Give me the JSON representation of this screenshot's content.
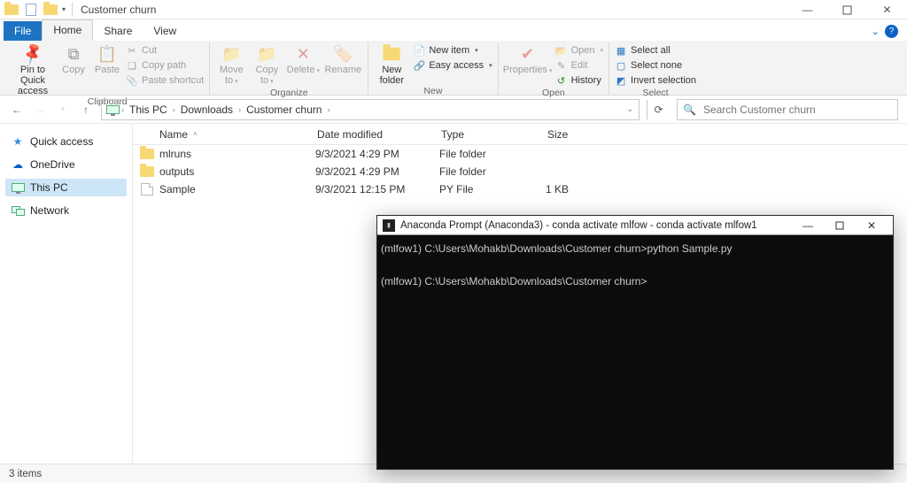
{
  "colors": {
    "accent": "#1e74c3",
    "selection": "#cde6f7"
  },
  "titlebar": {
    "window_title": "Customer churn"
  },
  "tabs": {
    "file": "File",
    "home": "Home",
    "share": "Share",
    "view": "View"
  },
  "ribbon": {
    "clipboard": {
      "label": "Clipboard",
      "pin": "Pin to Quick access",
      "copy": "Copy",
      "paste": "Paste",
      "cut": "Cut",
      "copy_path": "Copy path",
      "paste_shortcut": "Paste shortcut"
    },
    "organize": {
      "label": "Organize",
      "move_to": "Move to",
      "copy_to": "Copy to",
      "delete": "Delete",
      "rename": "Rename"
    },
    "new": {
      "label": "New",
      "new_folder": "New folder",
      "new_item": "New item",
      "easy_access": "Easy access"
    },
    "open": {
      "label": "Open",
      "properties": "Properties",
      "open": "Open",
      "edit": "Edit",
      "history": "History"
    },
    "select": {
      "label": "Select",
      "select_all": "Select all",
      "select_none": "Select none",
      "invert": "Invert selection"
    }
  },
  "breadcrumbs": {
    "root": "This PC",
    "mid": "Downloads",
    "leaf": "Customer churn"
  },
  "search": {
    "placeholder": "Search Customer churn"
  },
  "nav": {
    "quick_access": "Quick access",
    "onedrive": "OneDrive",
    "this_pc": "This PC",
    "network": "Network"
  },
  "columns": {
    "name": "Name",
    "date": "Date modified",
    "type": "Type",
    "size": "Size"
  },
  "files": [
    {
      "icon": "folder",
      "name": "mlruns",
      "date": "9/3/2021 4:29 PM",
      "type": "File folder",
      "size": ""
    },
    {
      "icon": "folder",
      "name": "outputs",
      "date": "9/3/2021 4:29 PM",
      "type": "File folder",
      "size": ""
    },
    {
      "icon": "pyfile",
      "name": "Sample",
      "date": "9/3/2021 12:15 PM",
      "type": "PY File",
      "size": "1 KB"
    }
  ],
  "status": {
    "items": "3 items"
  },
  "console": {
    "title": "Anaconda Prompt (Anaconda3) - conda  activate mlfow - conda  activate mlfow1",
    "line1": "(mlfow1) C:\\Users\\Mohakb\\Downloads\\Customer churn>python Sample.py",
    "line2": "(mlfow1) C:\\Users\\Mohakb\\Downloads\\Customer churn>"
  }
}
